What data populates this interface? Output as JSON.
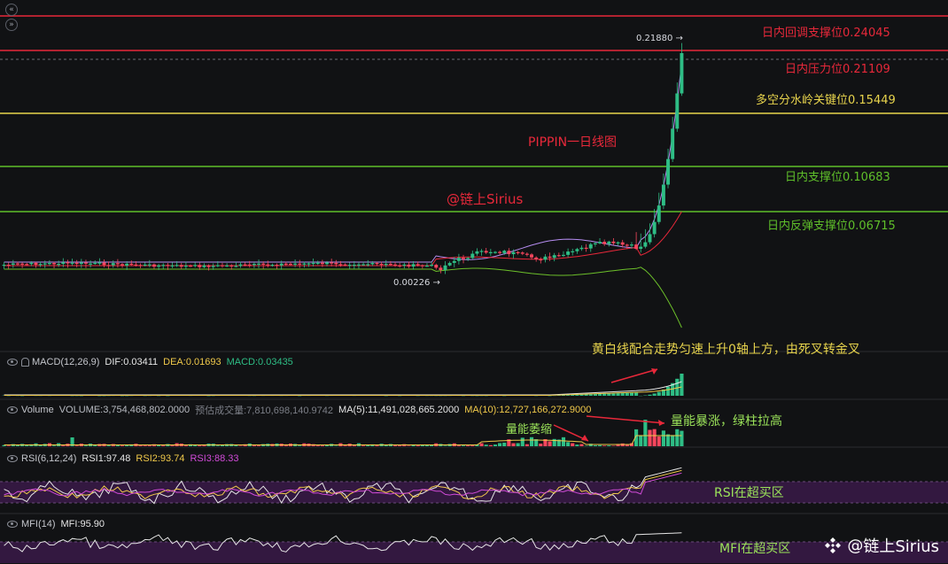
{
  "chart_data": {
    "type": "candlestick",
    "title": "PIPPIN一日线图",
    "author_tag": "@链上Sirius",
    "price_markers": {
      "high_label": "0.21880",
      "low_label": "0.00226"
    },
    "horizontal_levels": [
      {
        "label": "日内回调支撑位0.24045",
        "value": 0.24045,
        "color": "#e8283a"
      },
      {
        "label": "日内压力位0.21109",
        "value": 0.21109,
        "color": "#e8283a"
      },
      {
        "label": "多空分水岭关键位0.15449",
        "value": 0.15449,
        "color": "#e8d44d"
      },
      {
        "label": "日内支撑位0.10683",
        "value": 0.10683,
        "color": "#5fbf2a"
      },
      {
        "label": "日内反弹支撑位0.06715",
        "value": 0.06715,
        "color": "#5fbf2a"
      }
    ],
    "macd": {
      "name": "MACD(12,26,9)",
      "dif_label": "DIF:0.03411",
      "dea_label": "DEA:0.01693",
      "macd_label": "MACD:0.03435",
      "annotation": "黄白线配合走势匀速上升0轴上方，由死叉转金叉"
    },
    "volume": {
      "name": "Volume",
      "volume_label": "VOLUME:3,754,468,802.0000",
      "est_label": "预估成交量:7,810,698,140.9742",
      "ma5_label": "MA(5):11,491,028,665.2000",
      "ma10_label": "MA(10):12,727,166,272.9000",
      "annotation_shrink": "量能萎缩",
      "annotation_surge": "量能暴涨，绿柱拉高"
    },
    "rsi": {
      "name": "RSI(6,12,24)",
      "rsi1_label": "RSI1:97.48",
      "rsi2_label": "RSI2:93.74",
      "rsi3_label": "RSI3:88.33",
      "annotation": "RSI在超买区"
    },
    "mfi": {
      "name": "MFI(14)",
      "mfi_label": "MFI:95.90",
      "annotation": "MFI在超买区"
    },
    "colors": {
      "up": "#2ebd85",
      "down": "#f6465d",
      "background": "#111214",
      "band_upper": "#b58cf0",
      "band_mid": "#e8283a",
      "band_lower": "#6cbf2a",
      "annotation_yellow": "#e8d44d",
      "annotation_green": "#9be35a"
    }
  },
  "watermark": {
    "text": "链上Sirius"
  }
}
